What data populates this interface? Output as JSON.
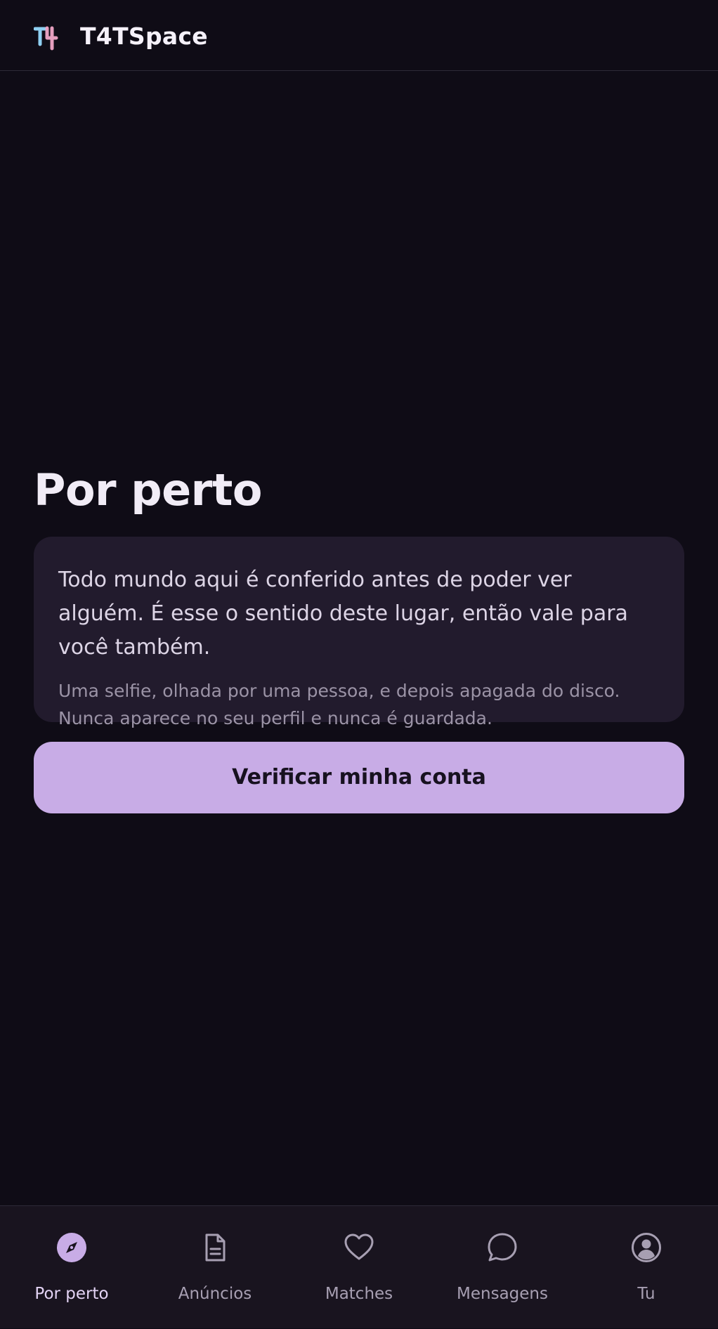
{
  "header": {
    "logo_glyph": "T4",
    "app_title": "T4TSpace"
  },
  "main": {
    "page_title": "Por perto",
    "notice": {
      "text": "Todo mundo aqui é conferido antes de poder ver alguém. É esse o sentido deste lugar, então vale para você também.",
      "subtext": "Uma selfie, olhada por uma pessoa, e depois apagada do disco. Nunca aparece no seu perfil e nunca é guardada."
    },
    "verify_button_label": "Verificar minha conta"
  },
  "bottom_nav": {
    "active_index": 0,
    "items": [
      {
        "label": "Por perto",
        "icon": "compass-icon"
      },
      {
        "label": "Anúncios",
        "icon": "document-icon"
      },
      {
        "label": "Matches",
        "icon": "heart-icon"
      },
      {
        "label": "Mensagens",
        "icon": "chat-bubble-icon"
      },
      {
        "label": "Tu",
        "icon": "user-circle-icon"
      }
    ]
  },
  "colors": {
    "background": "#0f0c16",
    "card": "#221b2d",
    "accent": "#c8ace6",
    "nav_background": "#19141f",
    "logo_blue": "#8fd0f2",
    "logo_pink": "#f2a8c8"
  }
}
